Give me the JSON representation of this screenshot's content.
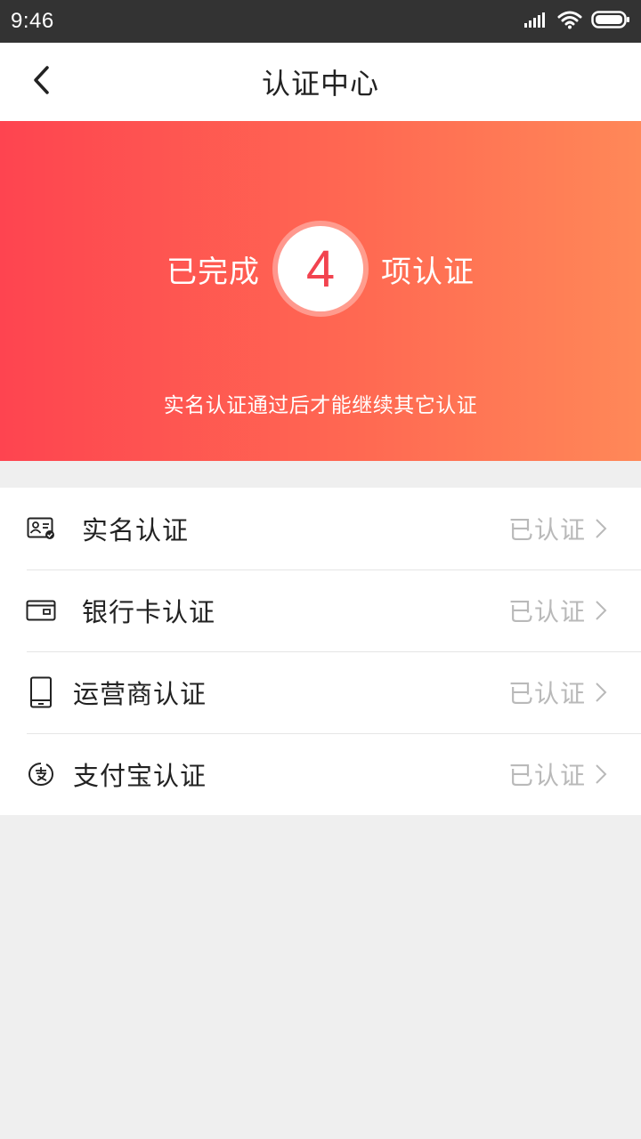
{
  "status_bar": {
    "time": "9:46"
  },
  "nav": {
    "title": "认证中心",
    "back_icon": "chevron-left-icon"
  },
  "banner": {
    "prefix": "已完成",
    "count": "4",
    "suffix": "项认证",
    "note": "实名认证通过后才能继续其它认证",
    "gradient_start": "#fe4450",
    "gradient_end": "#ff8858"
  },
  "items": [
    {
      "label": "实名认证",
      "status": "已认证",
      "icon": "id-card-icon"
    },
    {
      "label": "银行卡认证",
      "status": "已认证",
      "icon": "bank-card-icon"
    },
    {
      "label": "运营商认证",
      "status": "已认证",
      "icon": "phone-icon"
    },
    {
      "label": "支付宝认证",
      "status": "已认证",
      "icon": "alipay-icon"
    }
  ],
  "colors": {
    "accent": "#f2434f",
    "status_gray": "#b9b9b9",
    "background": "#efefef"
  }
}
